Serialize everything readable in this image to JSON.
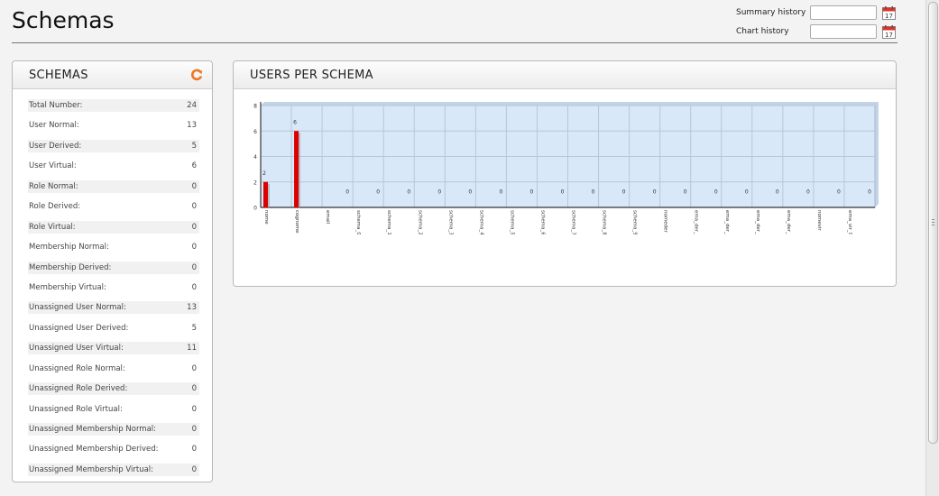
{
  "page": {
    "title": "Schemas"
  },
  "history": {
    "summary_label": "Summary history",
    "chart_label": "Chart history"
  },
  "schemas_panel": {
    "title": "SCHEMAS",
    "stats": [
      {
        "label": "Total Number:",
        "value": "24"
      },
      {
        "label": "User Normal:",
        "value": "13"
      },
      {
        "label": "User Derived:",
        "value": "5"
      },
      {
        "label": "User Virtual:",
        "value": "6"
      },
      {
        "label": "Role Normal:",
        "value": "0"
      },
      {
        "label": "Role Derived:",
        "value": "0"
      },
      {
        "label": "Role Virtual:",
        "value": "0"
      },
      {
        "label": "Membership Normal:",
        "value": "0"
      },
      {
        "label": "Membership Derived:",
        "value": "0"
      },
      {
        "label": "Membership Virtual:",
        "value": "0"
      },
      {
        "label": "Unassigned User Normal:",
        "value": "13"
      },
      {
        "label": "Unassigned User Derived:",
        "value": "5"
      },
      {
        "label": "Unassigned User Virtual:",
        "value": "11"
      },
      {
        "label": "Unassigned Role Normal:",
        "value": "0"
      },
      {
        "label": "Unassigned Role Derived:",
        "value": "0"
      },
      {
        "label": "Unassigned Role Virtual:",
        "value": "0"
      },
      {
        "label": "Unassigned Membership Normal:",
        "value": "0"
      },
      {
        "label": "Unassigned Membership Derived:",
        "value": "0"
      },
      {
        "label": "Unassigned Membership Virtual:",
        "value": "0"
      }
    ]
  },
  "users_panel": {
    "title": "USERS PER SCHEMA"
  },
  "colors": {
    "bar": "#dd0000",
    "plot_bg": "#d9e8f9",
    "accent_refresh": "#ee7722"
  },
  "chart_data": {
    "type": "bar",
    "categories": [
      "nome",
      "cognome",
      "email",
      "schema_0",
      "schema_1",
      "schema_2",
      "schema_3",
      "schema_4",
      "schema_5",
      "schema_6",
      "schema_7",
      "schema_8",
      "schema_9",
      "nomeder",
      "ema_der_0",
      "ema_der_1",
      "ema_der_2",
      "ema_der_3",
      "nomevir",
      "ema_vir_0"
    ],
    "values": [
      2,
      6,
      0,
      0,
      0,
      0,
      0,
      0,
      0,
      0,
      0,
      0,
      0,
      0,
      0,
      0,
      0,
      0,
      0,
      0
    ],
    "yticks": [
      "0",
      "2",
      "4",
      "6",
      "8"
    ],
    "ylim": [
      0,
      8
    ],
    "grid": true
  }
}
